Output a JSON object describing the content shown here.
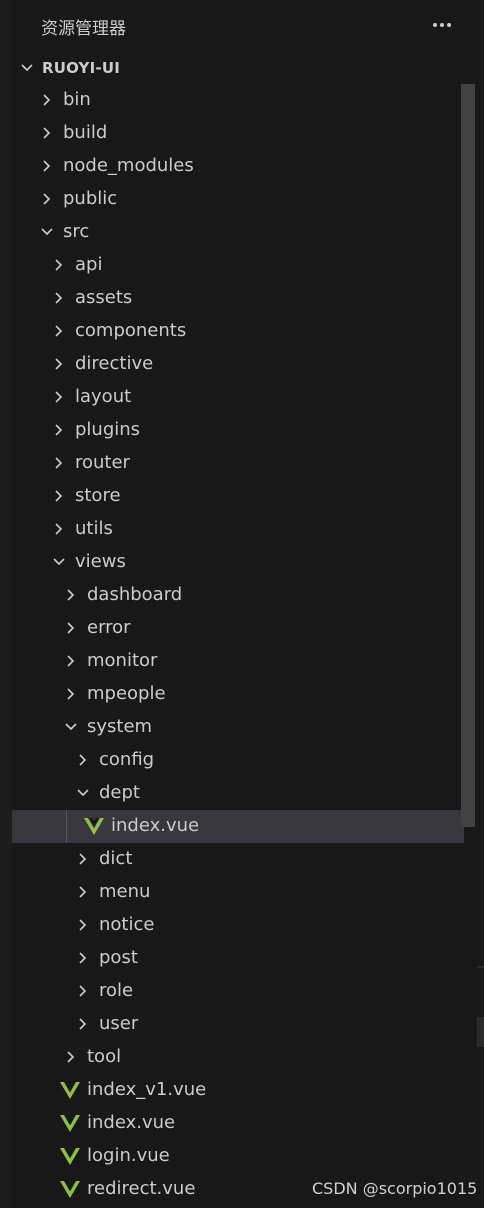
{
  "explorer": {
    "title": "资源管理器",
    "more_icon": "ellipsis-icon"
  },
  "section": {
    "label": "RUOYI-UI",
    "expanded": true
  },
  "tree": [
    {
      "name": "bin",
      "type": "folder",
      "expanded": false,
      "depth": 0
    },
    {
      "name": "build",
      "type": "folder",
      "expanded": false,
      "depth": 0
    },
    {
      "name": "node_modules",
      "type": "folder",
      "expanded": false,
      "depth": 0
    },
    {
      "name": "public",
      "type": "folder",
      "expanded": false,
      "depth": 0
    },
    {
      "name": "src",
      "type": "folder",
      "expanded": true,
      "depth": 0
    },
    {
      "name": "api",
      "type": "folder",
      "expanded": false,
      "depth": 1
    },
    {
      "name": "assets",
      "type": "folder",
      "expanded": false,
      "depth": 1
    },
    {
      "name": "components",
      "type": "folder",
      "expanded": false,
      "depth": 1
    },
    {
      "name": "directive",
      "type": "folder",
      "expanded": false,
      "depth": 1
    },
    {
      "name": "layout",
      "type": "folder",
      "expanded": false,
      "depth": 1
    },
    {
      "name": "plugins",
      "type": "folder",
      "expanded": false,
      "depth": 1
    },
    {
      "name": "router",
      "type": "folder",
      "expanded": false,
      "depth": 1
    },
    {
      "name": "store",
      "type": "folder",
      "expanded": false,
      "depth": 1
    },
    {
      "name": "utils",
      "type": "folder",
      "expanded": false,
      "depth": 1
    },
    {
      "name": "views",
      "type": "folder",
      "expanded": true,
      "depth": 1
    },
    {
      "name": "dashboard",
      "type": "folder",
      "expanded": false,
      "depth": 2
    },
    {
      "name": "error",
      "type": "folder",
      "expanded": false,
      "depth": 2
    },
    {
      "name": "monitor",
      "type": "folder",
      "expanded": false,
      "depth": 2
    },
    {
      "name": "mpeople",
      "type": "folder",
      "expanded": false,
      "depth": 2
    },
    {
      "name": "system",
      "type": "folder",
      "expanded": true,
      "depth": 2
    },
    {
      "name": "config",
      "type": "folder",
      "expanded": false,
      "depth": 3
    },
    {
      "name": "dept",
      "type": "folder",
      "expanded": true,
      "depth": 3
    },
    {
      "name": "index.vue",
      "type": "vue-file",
      "depth": 4,
      "selected": true
    },
    {
      "name": "dict",
      "type": "folder",
      "expanded": false,
      "depth": 3
    },
    {
      "name": "menu",
      "type": "folder",
      "expanded": false,
      "depth": 3
    },
    {
      "name": "notice",
      "type": "folder",
      "expanded": false,
      "depth": 3
    },
    {
      "name": "post",
      "type": "folder",
      "expanded": false,
      "depth": 3
    },
    {
      "name": "role",
      "type": "folder",
      "expanded": false,
      "depth": 3
    },
    {
      "name": "user",
      "type": "folder",
      "expanded": false,
      "depth": 3
    },
    {
      "name": "tool",
      "type": "folder",
      "expanded": false,
      "depth": 2
    },
    {
      "name": "index_v1.vue",
      "type": "vue-file",
      "depth": 2
    },
    {
      "name": "index.vue",
      "type": "vue-file",
      "depth": 2
    },
    {
      "name": "login.vue",
      "type": "vue-file",
      "depth": 2
    },
    {
      "name": "redirect.vue",
      "type": "vue-file",
      "depth": 2
    }
  ],
  "colors": {
    "background": "#181818",
    "selected_row": "#37373d",
    "text": "#cccccc",
    "vue_icon": "#8dc149",
    "scrollbar": "#424242"
  },
  "watermark": "CSDN @scorpio1015"
}
